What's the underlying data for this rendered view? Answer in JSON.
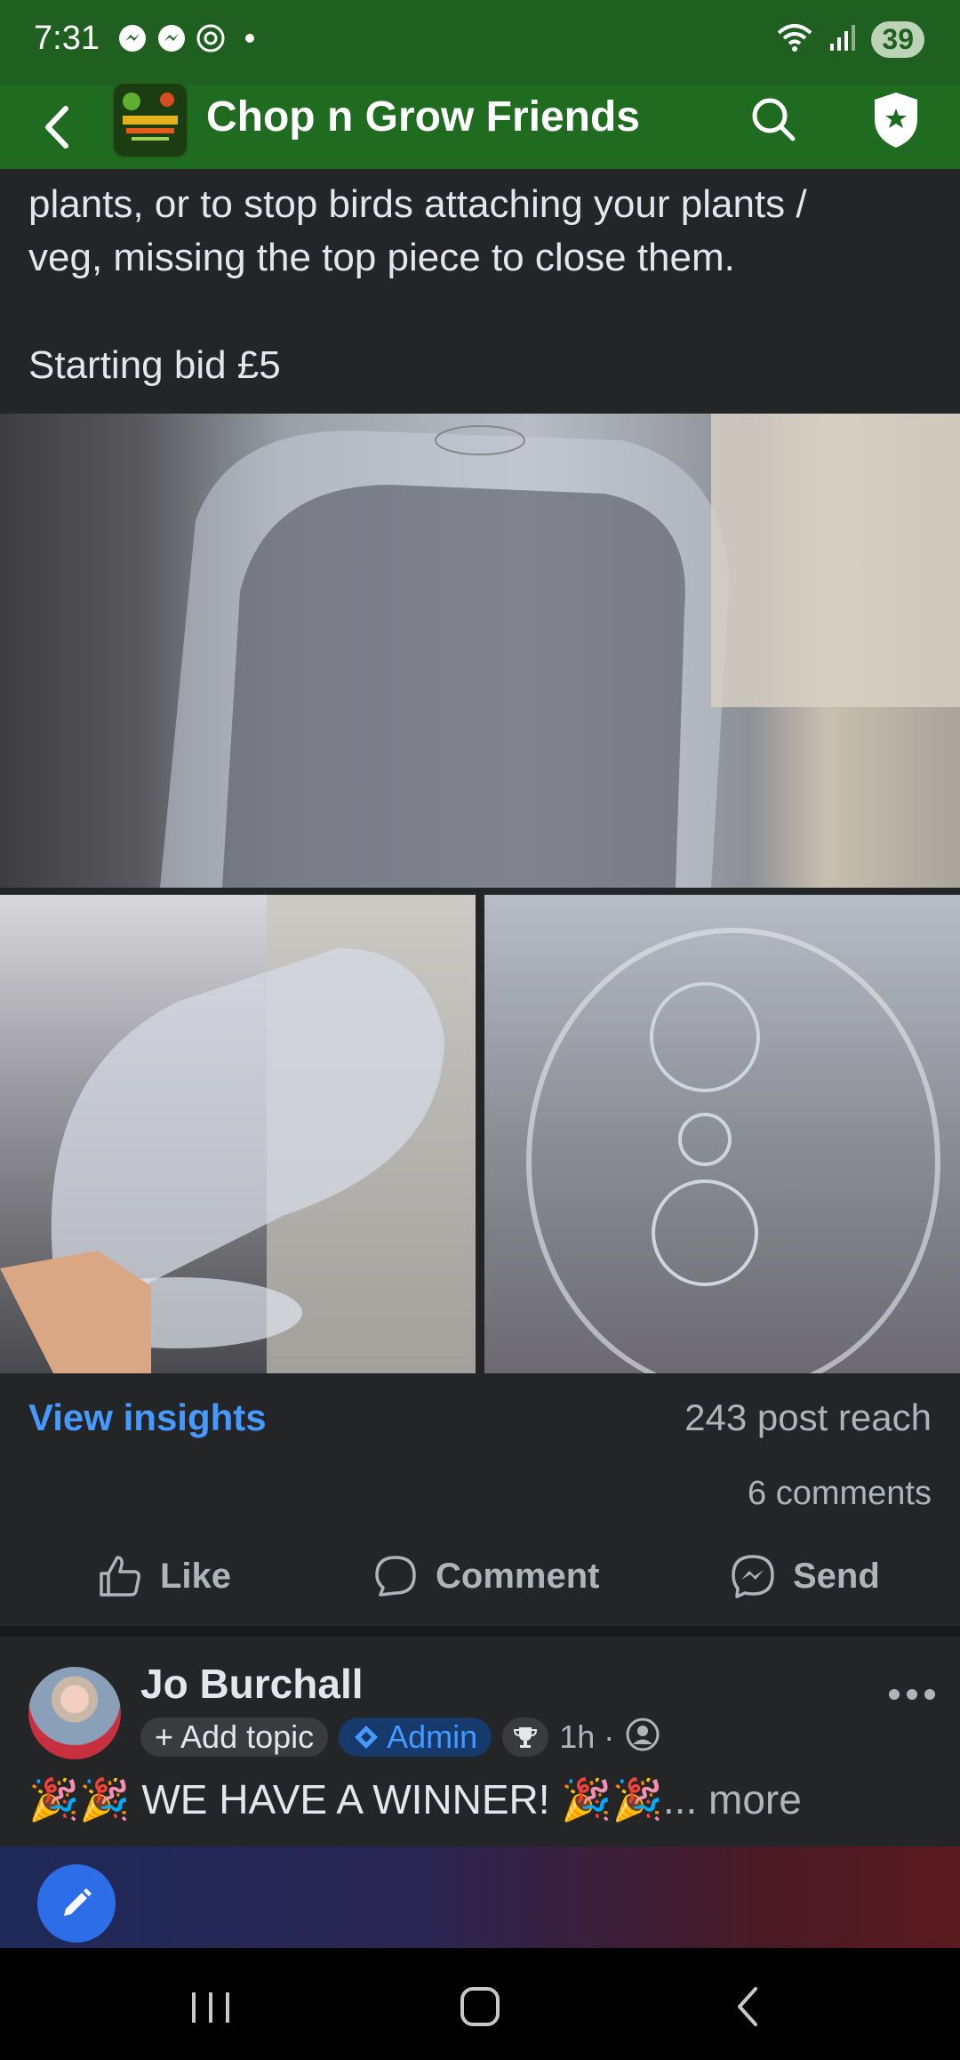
{
  "status_bar": {
    "time": "7:31",
    "battery": "39",
    "icons": [
      "messenger-icon",
      "messenger-icon",
      "threads-icon",
      "dot-icon",
      "wifi-icon",
      "signal-icon"
    ]
  },
  "header": {
    "title": "Chop n Grow Friends",
    "back_icon": "back-arrow-icon",
    "search_icon": "search-icon",
    "shield_icon": "admin-shield-icon"
  },
  "post": {
    "text_lines": [
      "plants, or to stop birds attaching your plants /",
      "veg, missing the top piece to close them."
    ],
    "starting_bid": "Starting bid £5",
    "view_insights": "View insights",
    "post_reach": "243 post reach",
    "comments_count": "6 comments",
    "actions": {
      "like": "Like",
      "comment": "Comment",
      "send": "Send"
    }
  },
  "next_post": {
    "author": "Jo Burchall",
    "add_topic": "+ Add topic",
    "admin_badge": "Admin",
    "time_ago": "1h ·",
    "message": "WE HAVE A WINNER!",
    "more": "... more"
  },
  "colors": {
    "status_bar": "#1f5f1f",
    "app_bar": "#1f6b1f",
    "background": "#242526",
    "link_blue": "#4599ff",
    "fab_blue": "#2d6ee8"
  }
}
